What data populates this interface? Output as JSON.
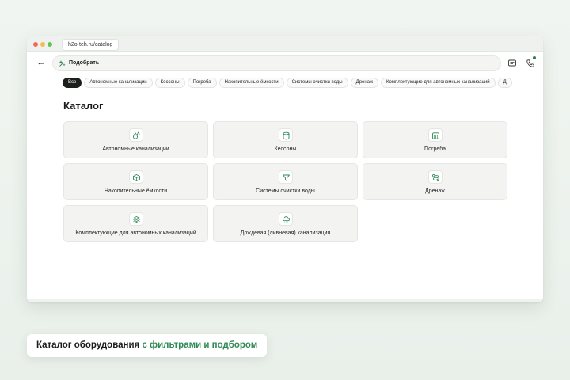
{
  "browser": {
    "url": "h2o-teh.ru/catalog"
  },
  "header": {
    "search_text": "Подобрать"
  },
  "chips": [
    {
      "label": "Все",
      "active": true
    },
    {
      "label": "Автономные канализации",
      "active": false
    },
    {
      "label": "Кессоны",
      "active": false
    },
    {
      "label": "Погреба",
      "active": false
    },
    {
      "label": "Накопительные ёмкости",
      "active": false
    },
    {
      "label": "Системы очистки воды",
      "active": false
    },
    {
      "label": "Дренаж",
      "active": false
    },
    {
      "label": "Комплектующие для автономных канализаций",
      "active": false
    },
    {
      "label": "Д",
      "active": false
    }
  ],
  "page": {
    "title": "Каталог"
  },
  "categories": [
    {
      "label": "Автономные канализации",
      "icon": "drops-icon"
    },
    {
      "label": "Кессоны",
      "icon": "cylinder-icon"
    },
    {
      "label": "Погреба",
      "icon": "cellar-icon"
    },
    {
      "label": "Накопительные ёмкости",
      "icon": "box-icon"
    },
    {
      "label": "Системы очистки воды",
      "icon": "filter-icon"
    },
    {
      "label": "Дренаж",
      "icon": "route-icon"
    },
    {
      "label": "Комплектующие для автономных канализаций",
      "icon": "layers-icon"
    },
    {
      "label": "Дождевая (ливневая) канализация",
      "icon": "rain-cloud-icon"
    }
  ],
  "caption": {
    "part1": "Каталог оборудования",
    "part2": "с фильтрами и подбором"
  },
  "colors": {
    "accent": "#2f8a57",
    "chip_active": "#1d1f1d",
    "card_bg": "#f3f3f1"
  }
}
